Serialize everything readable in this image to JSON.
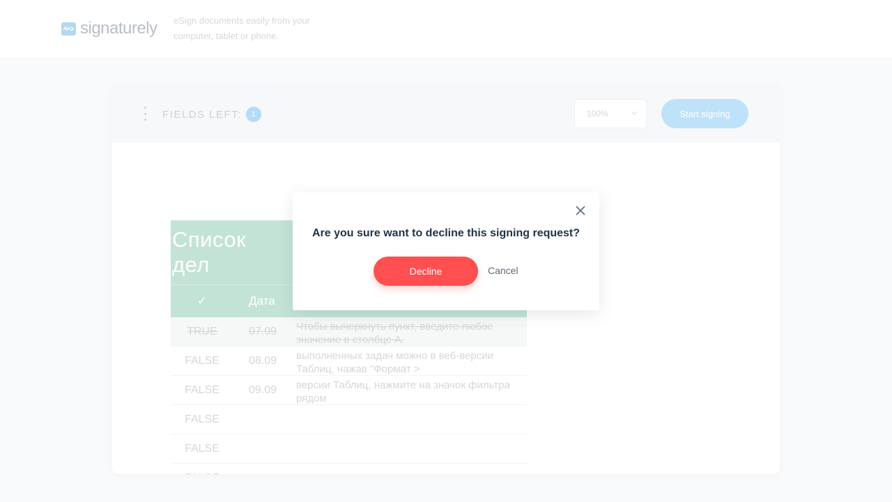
{
  "header": {
    "logo_text": "signaturely",
    "tagline": "eSign documents easily from your computer, tablet or phone."
  },
  "toolbar": {
    "fields_left_label": "FIELDS LEFT:",
    "fields_left_count": "1",
    "zoom_value": "100%",
    "start_signing_label": "Start signing"
  },
  "document": {
    "title": "Список дел",
    "header": {
      "check": "✓",
      "date": "Дата"
    },
    "rows": [
      {
        "status": "TRUE",
        "date": "07.09",
        "text": "Чтобы вычеркнуть пункт, введите любое значение в столбце A."
      },
      {
        "status": "FALSE",
        "date": "08.09",
        "text": "выполненных задач можно в веб-версии Таблиц, нажав \"Формат >"
      },
      {
        "status": "FALSE",
        "date": "09.09",
        "text": "версии Таблиц, нажмите на значок фильтра рядом"
      },
      {
        "status": "FALSE",
        "date": "",
        "text": ""
      },
      {
        "status": "FALSE",
        "date": "",
        "text": ""
      },
      {
        "status": "FALSE",
        "date": "",
        "text": ""
      }
    ]
  },
  "modal": {
    "title": "Are you sure want to decline this signing request?",
    "decline_label": "Decline",
    "cancel_label": "Cancel"
  },
  "colors": {
    "accent": "#ff4f51",
    "primary_light": "#bfe2fb",
    "title_text": "#1f3349",
    "doc_header_bg": "#c3e3d6"
  }
}
